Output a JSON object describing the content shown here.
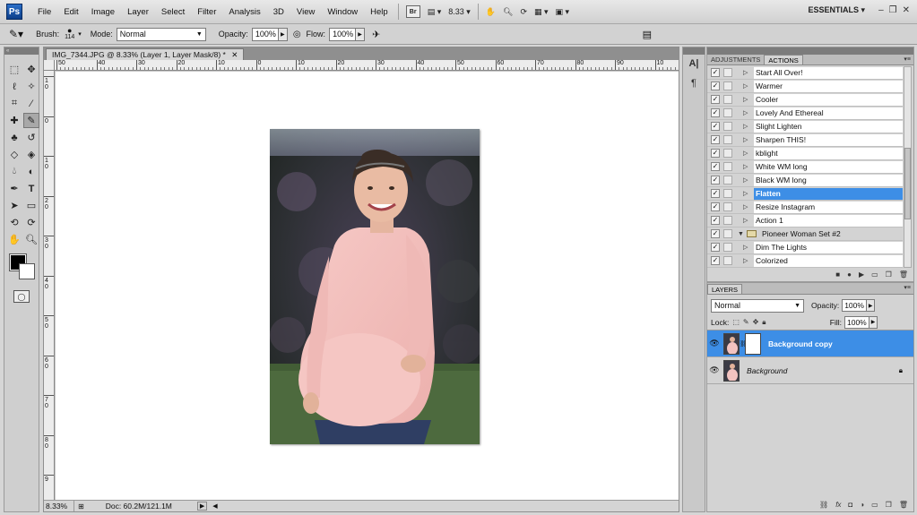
{
  "menubar": {
    "logo": "Ps",
    "menus": [
      "File",
      "Edit",
      "Image",
      "Layer",
      "Select",
      "Filter",
      "Analysis",
      "3D",
      "View",
      "Window",
      "Help"
    ],
    "bridge_label": "Br",
    "zoom_value": "8.33",
    "workspace": "ESSENTIALS"
  },
  "options": {
    "brush_label": "Brush:",
    "brush_size": "114",
    "mode_label": "Mode:",
    "mode_value": "Normal",
    "opacity_label": "Opacity:",
    "opacity_value": "100%",
    "flow_label": "Flow:",
    "flow_value": "100%"
  },
  "document": {
    "tab_title": "IMG_7344.JPG @ 8.33% (Layer 1, Layer Mask/8) *",
    "ruler_top": [
      "50",
      "40",
      "30",
      "20",
      "10",
      "0",
      "10",
      "20",
      "30",
      "40",
      "50",
      "60",
      "70",
      "80",
      "90",
      "10"
    ],
    "ruler_left": [
      "1 0",
      "0",
      "1 0",
      "2 0",
      "3 0",
      "4 0",
      "5 0",
      "6 0",
      "7 0",
      "8 0",
      "9"
    ],
    "status_zoom": "8.33%",
    "status_doc": "Doc: 60.2M/121.1M"
  },
  "actions_panel": {
    "tabs": [
      "ADJUSTMENTS",
      "ACTIONS"
    ],
    "active_tab": "ACTIONS",
    "items": [
      {
        "name": "Start All Over!",
        "type": "action"
      },
      {
        "name": "Warmer",
        "type": "action"
      },
      {
        "name": "Cooler",
        "type": "action"
      },
      {
        "name": "Lovely And Ethereal",
        "type": "action"
      },
      {
        "name": "Slight Lighten",
        "type": "action"
      },
      {
        "name": "Sharpen THIS!",
        "type": "action"
      },
      {
        "name": "kblight",
        "type": "action"
      },
      {
        "name": "White WM long",
        "type": "action"
      },
      {
        "name": "Black WM long",
        "type": "action"
      },
      {
        "name": "Flatten",
        "type": "action",
        "selected": true
      },
      {
        "name": "Resize Instagram",
        "type": "action"
      },
      {
        "name": "Action 1",
        "type": "action"
      },
      {
        "name": "Pioneer Woman Set #2",
        "type": "set"
      },
      {
        "name": "Dim The Lights",
        "type": "action"
      },
      {
        "name": "Colorized",
        "type": "action"
      }
    ]
  },
  "layers_panel": {
    "title": "LAYERS",
    "blend_mode": "Normal",
    "opacity_label": "Opacity:",
    "opacity_value": "100%",
    "lock_label": "Lock:",
    "fill_label": "Fill:",
    "fill_value": "100%",
    "layers": [
      {
        "name": "Background copy",
        "active": true
      },
      {
        "name": "Background",
        "active": false
      }
    ]
  },
  "colors": {
    "selection": "#3d8ee6",
    "panel_bg": "#d3d3d3",
    "header_bar": "#7c7c7c"
  }
}
